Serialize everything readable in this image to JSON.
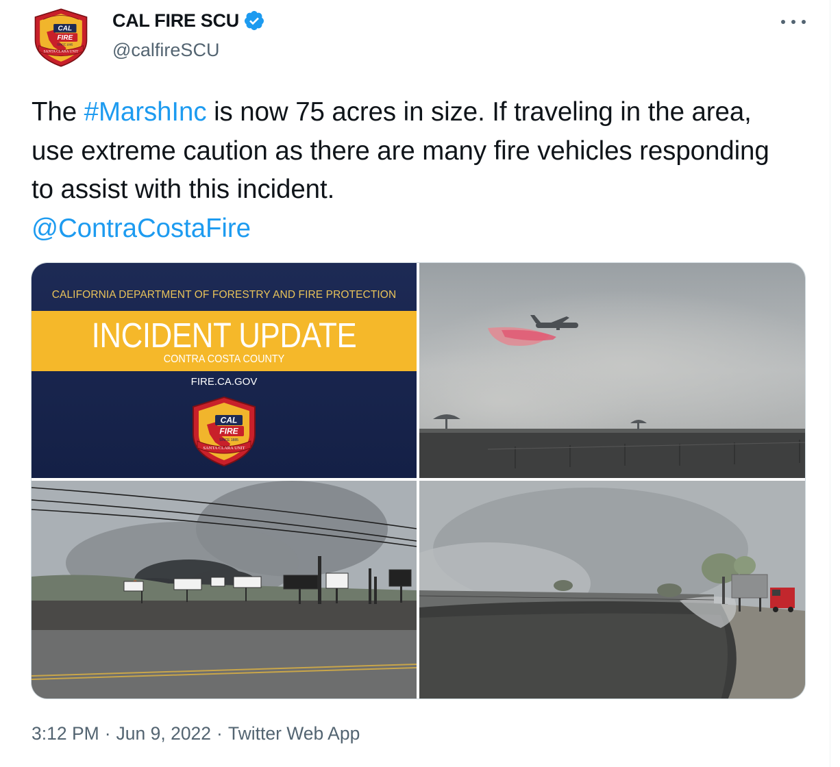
{
  "author": {
    "display_name": "CAL FIRE SCU",
    "handle": "@calfireSCU",
    "verified": true,
    "avatar_icon": "cal-fire-badge-icon"
  },
  "tweet": {
    "text_parts": [
      {
        "type": "text",
        "value": "The "
      },
      {
        "type": "link",
        "value": "#MarshInc"
      },
      {
        "type": "text",
        "value": " is now 75 acres in size.  If traveling in the area, use extreme caution as there are many fire vehicles responding to assist with this incident. "
      },
      {
        "type": "link",
        "value": "@ContraCostaFire"
      }
    ]
  },
  "badge": {
    "line1": "CALIFORNIA DEPARTMENT OF FORESTRY & FIRE PROTECTION",
    "cal": "CAL",
    "fire": "FIRE",
    "since": "SINCE 1885",
    "unit": "SANTA CLARA UNIT"
  },
  "media": {
    "incident_graphic": {
      "department": "CALIFORNIA DEPARTMENT OF FORESTRY AND FIRE PROTECTION",
      "headline": "INCIDENT UPDATE",
      "county": "CONTRA COSTA COUNTY",
      "website": "FIRE.CA.GOV"
    },
    "photos": [
      {
        "name": "air-tanker-retardant-drop-photo"
      },
      {
        "name": "roadside-fire-billboards-photo"
      },
      {
        "name": "burned-field-fire-engine-photo"
      }
    ]
  },
  "meta": {
    "time": "3:12 PM",
    "separator": "·",
    "date": "Jun 9, 2022",
    "source": "Twitter Web App"
  },
  "colors": {
    "link": "#1d9bf0",
    "secondary_text": "#536471",
    "verified": "#1d9bf0",
    "banner_navy": "#1d2a55",
    "banner_yellow": "#f5b82a"
  },
  "icons": {
    "more": "more-options-icon",
    "verified": "verified-badge-icon"
  }
}
